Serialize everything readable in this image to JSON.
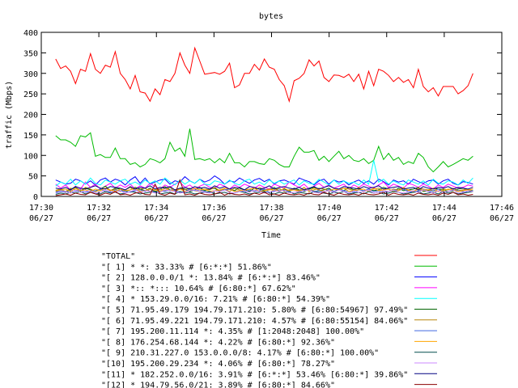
{
  "chart_data": {
    "type": "line",
    "title": "bytes",
    "xlabel": "Time",
    "ylabel": "traffic (Mbps)",
    "ylim": [
      0,
      400
    ],
    "xlim": [
      "06/27 17:30",
      "06/27 17:46"
    ],
    "y_ticks": [
      0,
      50,
      100,
      150,
      200,
      250,
      300,
      350,
      400
    ],
    "x_ticks": [
      {
        "time": "17:30",
        "date": "06/27"
      },
      {
        "time": "17:32",
        "date": "06/27"
      },
      {
        "time": "17:34",
        "date": "06/27"
      },
      {
        "time": "17:36",
        "date": "06/27"
      },
      {
        "time": "17:38",
        "date": "06/27"
      },
      {
        "time": "17:40",
        "date": "06/27"
      },
      {
        "time": "17:42",
        "date": "06/27"
      },
      {
        "time": "17:44",
        "date": "06/27"
      },
      {
        "time": "17:46",
        "date": "06/27"
      }
    ],
    "grid": false,
    "legend_position": "bottom",
    "x": [
      "06/27 17:30:30",
      "06/27 17:30:45",
      "06/27 17:31:00",
      "06/27 17:31:15",
      "06/27 17:31:30",
      "06/27 17:31:45",
      "06/27 17:32:00",
      "06/27 17:32:15",
      "06/27 17:32:30",
      "06/27 17:32:45",
      "06/27 17:33:00",
      "06/27 17:33:15",
      "06/27 17:33:30",
      "06/27 17:33:45",
      "06/27 17:34:00",
      "06/27 17:34:15",
      "06/27 17:34:30",
      "06/27 17:34:45",
      "06/27 17:35:00",
      "06/27 17:35:15",
      "06/27 17:35:30",
      "06/27 17:35:45",
      "06/27 17:36:00",
      "06/27 17:36:15",
      "06/27 17:36:30",
      "06/27 17:36:45",
      "06/27 17:37:00",
      "06/27 17:37:15",
      "06/27 17:37:30",
      "06/27 17:37:45",
      "06/27 17:38:00",
      "06/27 17:38:15",
      "06/27 17:38:30",
      "06/27 17:38:45",
      "06/27 17:39:00",
      "06/27 17:39:15",
      "06/27 17:39:30",
      "06/27 17:39:45",
      "06/27 17:40:00",
      "06/27 17:40:15",
      "06/27 17:40:30",
      "06/27 17:40:45",
      "06/27 17:41:00",
      "06/27 17:41:15",
      "06/27 17:41:30",
      "06/27 17:41:45",
      "06/27 17:42:00",
      "06/27 17:42:15",
      "06/27 17:42:30",
      "06/27 17:42:45",
      "06/27 17:43:00",
      "06/27 17:43:15",
      "06/27 17:43:30",
      "06/27 17:43:45",
      "06/27 17:44:00",
      "06/27 17:44:15",
      "06/27 17:44:30",
      "06/27 17:44:45",
      "06/27 17:45:00"
    ],
    "series": [
      {
        "name": "\"TOTAL\"",
        "color": "#ff0000",
        "values": [
          335,
          312,
          318,
          305,
          275,
          310,
          305,
          348,
          310,
          300,
          320,
          315,
          353,
          300,
          285,
          262,
          295,
          255,
          252,
          232,
          262,
          248,
          285,
          280,
          300,
          350,
          320,
          300,
          362,
          330,
          298,
          300,
          302,
          298,
          305,
          325,
          265,
          272,
          300,
          300,
          322,
          308,
          335,
          315,
          310,
          285,
          270,
          232,
          282,
          288,
          300,
          333,
          318,
          330,
          290,
          280,
          296,
          295,
          290,
          298,
          280,
          298,
          262,
          305,
          270,
          310,
          305,
          295,
          280,
          290,
          278,
          285,
          265,
          310,
          268,
          255,
          265,
          245,
          268,
          268,
          268,
          250,
          258,
          270,
          300
        ]
      },
      {
        "name": "\"[ 1] * *: 33.33% # [6:*:*] 51.86%\"",
        "color": "#00bb00",
        "values": [
          148,
          138,
          138,
          132,
          122,
          148,
          145,
          155,
          98,
          102,
          95,
          95,
          118,
          92,
          92,
          78,
          82,
          72,
          78,
          92,
          88,
          82,
          92,
          132,
          110,
          118,
          98,
          165,
          90,
          92,
          88,
          92,
          82,
          92,
          82,
          105,
          82,
          82,
          72,
          85,
          85,
          80,
          78,
          92,
          88,
          78,
          72,
          72,
          98,
          120,
          108,
          108,
          112,
          88,
          98,
          85,
          98,
          110,
          92,
          100,
          88,
          85,
          92,
          80,
          88,
          122,
          90,
          105,
          88,
          95,
          78,
          85,
          80,
          105,
          95,
          72,
          60,
          72,
          85,
          72,
          78,
          85,
          92,
          88,
          98
        ]
      },
      {
        "name": "\"[ 2] 128.0.0.0/1 *: 13.84% # [6:*:*] 83.46%\"",
        "color": "#0000ff",
        "values": [
          40,
          35,
          30,
          32,
          42,
          38,
          30,
          38,
          28,
          40,
          45,
          35,
          42,
          38,
          28,
          40,
          48,
          32,
          45,
          30,
          35,
          40,
          42,
          30,
          38,
          35,
          48,
          38,
          32,
          42,
          35,
          40,
          50,
          42,
          30,
          38,
          35,
          45,
          38,
          32,
          40,
          44,
          36,
          42,
          30,
          38,
          40,
          35,
          30,
          45,
          40,
          36,
          28,
          38,
          42,
          30,
          40,
          35,
          38,
          28,
          35,
          40,
          32,
          38,
          30,
          42,
          36,
          28,
          40,
          35,
          38,
          30,
          42,
          36,
          32,
          38,
          40,
          30,
          38,
          42,
          32,
          28,
          36,
          34,
          30
        ]
      },
      {
        "name": "\"[ 3] *:: *::: 10.64% # [6:80:*] 67.62%\"",
        "color": "#ff00ff",
        "values": [
          30,
          20,
          28,
          15,
          25,
          18,
          35,
          22,
          30,
          18,
          25,
          32,
          20,
          28,
          22,
          30,
          18,
          26,
          20,
          32,
          24,
          18,
          28,
          22,
          30,
          35,
          22,
          28,
          18,
          25,
          30,
          22,
          20,
          30,
          25,
          18,
          28,
          22,
          30,
          25,
          20,
          28,
          22,
          18,
          30,
          25,
          20,
          35,
          28,
          22,
          30,
          18,
          25,
          32,
          22,
          28,
          20,
          25,
          30,
          18,
          28,
          22,
          30,
          25,
          20,
          28,
          35,
          22,
          30,
          25,
          20,
          32,
          28,
          22,
          30,
          25,
          18,
          28,
          22,
          30,
          25,
          20,
          22,
          28,
          25
        ]
      },
      {
        "name": "\"[ 4] * 153.29.0.0/16: 7.21% # [6:80:*] 54.39%\"",
        "color": "#00ffff",
        "values": [
          25,
          35,
          30,
          42,
          28,
          38,
          30,
          45,
          32,
          28,
          40,
          35,
          30,
          38,
          42,
          30,
          35,
          28,
          40,
          32,
          38,
          30,
          45,
          35,
          28,
          40,
          30,
          38,
          32,
          42,
          30,
          28,
          38,
          35,
          30,
          40,
          32,
          28,
          38,
          42,
          30,
          35,
          28,
          40,
          32,
          38,
          30,
          35,
          40,
          28,
          38,
          32,
          30,
          42,
          35,
          28,
          40,
          30,
          38,
          32,
          35,
          28,
          40,
          30,
          88,
          35,
          42,
          30,
          38,
          32,
          28,
          40,
          35,
          30,
          38,
          28,
          42,
          32,
          30,
          38,
          35,
          28,
          40,
          32,
          45
        ]
      },
      {
        "name": "\"[ 5] 71.95.49.179 194.79.171.210: 5.80% # [6:80:54967] 97.49%\"",
        "color": "#006400",
        "values": [
          12,
          15,
          10,
          18,
          22,
          14,
          20,
          16,
          12,
          18,
          25,
          14,
          20,
          18,
          12,
          16,
          22,
          18,
          14,
          20,
          12,
          18,
          24,
          16,
          14,
          20,
          18,
          12,
          16,
          22,
          14,
          18,
          20,
          12,
          16,
          18,
          14,
          22,
          16,
          12,
          20,
          18,
          14,
          16,
          22,
          12,
          18,
          14,
          20,
          16,
          12,
          18,
          22,
          14,
          16,
          20,
          12,
          18,
          14,
          22,
          16,
          20,
          12,
          18,
          14,
          16,
          22,
          18,
          12,
          20,
          14,
          16,
          18,
          22,
          12,
          14,
          20,
          18,
          16,
          12,
          14,
          18,
          20,
          16,
          14
        ]
      },
      {
        "name": "\"[ 6] 71.95.49.221 194.79.171.210: 4.57% # [6:80:55154] 84.06%\"",
        "color": "#b8860b",
        "values": [
          15,
          18,
          12,
          20,
          16,
          14,
          22,
          18,
          12,
          16,
          20,
          14,
          18,
          12,
          16,
          22,
          14,
          18,
          20,
          12,
          16,
          18,
          14,
          22,
          12,
          18,
          16,
          20,
          14,
          12,
          18,
          16,
          22,
          14,
          18,
          12,
          20,
          16,
          14,
          18,
          12,
          22,
          16,
          18,
          14,
          20,
          12,
          16,
          18,
          14,
          22,
          12,
          16,
          20,
          18,
          14,
          12,
          16,
          20,
          18,
          14,
          22,
          12,
          16,
          18,
          20,
          14,
          12,
          18,
          16,
          22,
          14,
          12,
          20,
          18,
          16,
          14,
          12,
          18,
          16,
          20,
          14,
          16,
          18,
          12
        ]
      },
      {
        "name": "\"[ 7] 195.200.11.114 *: 4.35% # [1:2048:2048] 100.00%\"",
        "color": "#4169e1",
        "values": [
          8,
          12,
          10,
          14,
          12,
          16,
          10,
          12,
          14,
          18,
          12,
          10,
          16,
          14,
          12,
          10,
          14,
          16,
          12,
          18,
          10,
          14,
          12,
          16,
          14,
          10,
          12,
          18,
          14,
          16,
          12,
          10,
          14,
          12,
          16,
          18,
          12,
          14,
          10,
          16,
          12,
          14,
          18,
          10,
          12,
          16,
          14,
          12,
          18,
          10,
          14,
          16,
          12,
          14,
          10,
          18,
          12,
          16,
          14,
          12,
          10,
          16,
          14,
          18,
          12,
          14,
          10,
          12,
          16,
          14,
          18,
          12,
          10,
          14,
          16,
          12,
          14,
          18,
          10,
          12,
          16,
          14,
          12,
          10,
          14
        ]
      },
      {
        "name": "\"[ 8] 176.254.68.144 *: 4.22% # [6:80:*] 92.36%\"",
        "color": "#ffa500",
        "values": [
          14,
          16,
          18,
          12,
          20,
          14,
          16,
          12,
          18,
          14,
          20,
          16,
          12,
          18,
          14,
          16,
          20,
          12,
          14,
          18,
          16,
          12,
          20,
          14,
          16,
          18,
          12,
          14,
          20,
          16,
          18,
          12,
          14,
          16,
          20,
          18,
          12,
          14,
          16,
          18,
          20,
          12,
          14,
          16,
          18,
          12,
          20,
          14,
          16,
          12,
          18,
          14,
          20,
          16,
          12,
          14,
          18,
          16,
          20,
          12,
          14,
          16,
          18,
          12,
          20,
          14,
          16,
          18,
          12,
          14,
          20,
          16,
          12,
          18,
          14,
          16,
          20,
          12,
          14,
          18,
          16,
          12,
          14,
          16,
          18
        ]
      },
      {
        "name": "\"[ 9] 210.31.227.0 153.0.0.0/8: 4.17% # [6:80:*] 100.00%\"",
        "color": "#004d4d",
        "values": [
          5,
          8,
          6,
          10,
          8,
          12,
          6,
          10,
          8,
          6,
          12,
          8,
          10,
          6,
          8,
          12,
          10,
          6,
          8,
          10,
          12,
          6,
          8,
          10,
          6,
          12,
          8,
          10,
          6,
          8,
          10,
          12,
          6,
          8,
          10,
          6,
          8,
          12,
          10,
          6,
          8,
          10,
          12,
          8,
          6,
          10,
          8,
          12,
          6,
          10,
          8,
          6,
          12,
          10,
          8,
          6,
          10,
          8,
          12,
          6,
          8,
          10,
          6,
          12,
          8,
          10,
          6,
          8,
          12,
          10,
          6,
          8,
          10,
          12,
          6,
          8,
          10,
          6,
          12,
          8,
          10,
          6,
          8,
          10,
          12
        ]
      },
      {
        "name": "\"[10] 195.200.29.234 *: 4.06% # [6:80:*] 78.27%\"",
        "color": "#cc88ff",
        "values": [
          10,
          14,
          12,
          8,
          16,
          10,
          12,
          14,
          8,
          10,
          16,
          12,
          10,
          14,
          8,
          12,
          16,
          10,
          14,
          12,
          8,
          10,
          16,
          14,
          12,
          8,
          10,
          14,
          16,
          12,
          10,
          8,
          14,
          12,
          16,
          10,
          8,
          12,
          14,
          10,
          16,
          12,
          8,
          10,
          14,
          12,
          16,
          8,
          10,
          12,
          14,
          16,
          10,
          8,
          12,
          14,
          10,
          16,
          12,
          8,
          14,
          10,
          12,
          16,
          8,
          10,
          14,
          12,
          16,
          10,
          8,
          12,
          14,
          10,
          16,
          12,
          8,
          14,
          10,
          12,
          16,
          8,
          10,
          14,
          12
        ]
      },
      {
        "name": "\"[11] * 182.252.0.0/16: 3.91% # [6:*:*] 53.46% [6:80:*] 39.86%\"",
        "color": "#000080",
        "values": [
          20,
          18,
          22,
          16,
          24,
          20,
          18,
          22,
          26,
          20,
          18,
          24,
          22,
          20,
          16,
          24,
          18,
          22,
          20,
          26,
          18,
          22,
          20,
          24,
          16,
          20,
          22,
          18,
          24,
          20,
          22,
          18,
          26,
          20,
          24,
          18,
          22,
          20,
          16,
          24,
          22,
          18,
          20,
          26,
          18,
          22,
          24,
          20,
          18,
          22,
          16,
          20,
          24,
          18,
          22,
          26,
          20,
          18,
          24,
          22,
          20,
          18,
          24,
          20,
          22,
          26,
          18,
          20,
          22,
          24,
          18,
          20,
          22,
          16,
          24,
          20,
          18,
          22,
          20,
          24,
          18,
          22,
          20,
          18,
          22
        ]
      },
      {
        "name": "\"[12] * 194.79.56.0/21: 3.89% # [6:80:*] 84.66%\"",
        "color": "#8b0000",
        "values": [
          2,
          4,
          6,
          3,
          8,
          5,
          4,
          10,
          6,
          3,
          8,
          5,
          12,
          4,
          6,
          3,
          8,
          10,
          5,
          4,
          30,
          6,
          3,
          8,
          5,
          40,
          4,
          6,
          3,
          8,
          5,
          4,
          6,
          10,
          3,
          8,
          5,
          4,
          6,
          3,
          8,
          5,
          10,
          4,
          6,
          3,
          8,
          5,
          4,
          6,
          3,
          8,
          5,
          4,
          10,
          6,
          3,
          8,
          5,
          4,
          6,
          3,
          8,
          5,
          4,
          6,
          10,
          3,
          8,
          5,
          4,
          6,
          3,
          8,
          5,
          4,
          6,
          3,
          8,
          5,
          10,
          4,
          6,
          3,
          5
        ]
      }
    ]
  }
}
